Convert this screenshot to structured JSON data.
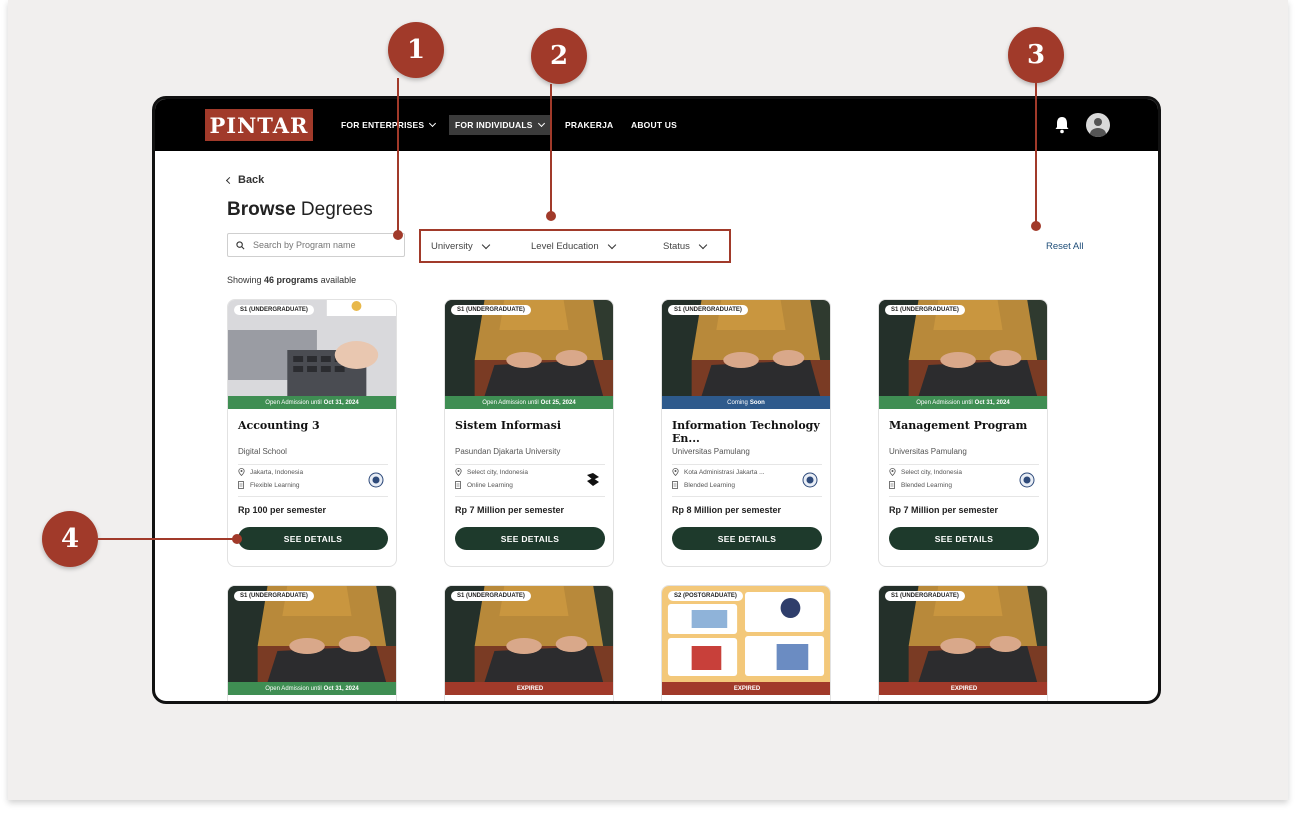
{
  "nav": {
    "logo": "PINTAR",
    "items": [
      "FOR ENTERPRISES",
      "FOR INDIVIDUALS",
      "PRAKERJA",
      "ABOUT US"
    ]
  },
  "page": {
    "back_label": "Back",
    "title_bold": "Browse",
    "title_rest": "Degrees",
    "search_placeholder": "Search by Program name",
    "filters": [
      "University",
      "Level Education",
      "Status"
    ],
    "reset_label": "Reset All",
    "showing_prefix": "Showing",
    "showing_count": "46 programs",
    "showing_suffix": "available",
    "details_button": "SEE DETAILS"
  },
  "cards_row1": [
    {
      "badge": "S1 (UNDERGRADUATE)",
      "status_prefix": "Open Admission until",
      "status_bold": "Oct 31, 2024",
      "status_color": "#3f8e53",
      "title": "Accounting 3",
      "university": "Digital School",
      "location": "Jakarta, Indonesia",
      "mode": "Flexible Learning",
      "price": "Rp 100 per semester"
    },
    {
      "badge": "S1 (UNDERGRADUATE)",
      "status_prefix": "Open Admission until",
      "status_bold": "Oct 25, 2024",
      "status_color": "#3f8e53",
      "title": "Sistem Informasi",
      "university": "Pasundan Djakarta University",
      "location": "Select city, Indonesia",
      "mode": "Online Learning",
      "price": "Rp 7 Million per semester"
    },
    {
      "badge": "S1 (UNDERGRADUATE)",
      "status_prefix": "Coming",
      "status_bold": "Soon",
      "status_color": "#2e5a8c",
      "title": "Information Technology En...",
      "university": "Universitas Pamulang",
      "location": "Kota Administrasi Jakarta ...",
      "mode": "Blended Learning",
      "price": "Rp 8 Million per semester"
    },
    {
      "badge": "S1 (UNDERGRADUATE)",
      "status_prefix": "Open Admission until",
      "status_bold": "Oct 31, 2024",
      "status_color": "#3f8e53",
      "title": "Management Program",
      "university": "Universitas Pamulang",
      "location": "Select city, Indonesia",
      "mode": "Blended Learning",
      "price": "Rp 7 Million per semester"
    }
  ],
  "cards_row2": [
    {
      "badge": "S1 (UNDERGRADUATE)",
      "status_prefix": "Open Admission until",
      "status_bold": "Oct 31, 2024",
      "status_color": "#3f8e53"
    },
    {
      "badge": "S1 (UNDERGRADUATE)",
      "status_prefix": "",
      "status_bold": "EXPIRED",
      "status_color": "#a13a2a"
    },
    {
      "badge": "S2 (POSTGRADUATE)",
      "status_prefix": "",
      "status_bold": "EXPIRED",
      "status_color": "#a13a2a"
    },
    {
      "badge": "S1 (UNDERGRADUATE)",
      "status_prefix": "",
      "status_bold": "EXPIRED",
      "status_color": "#a13a2a"
    }
  ],
  "markers": [
    "1",
    "2",
    "3",
    "4"
  ]
}
